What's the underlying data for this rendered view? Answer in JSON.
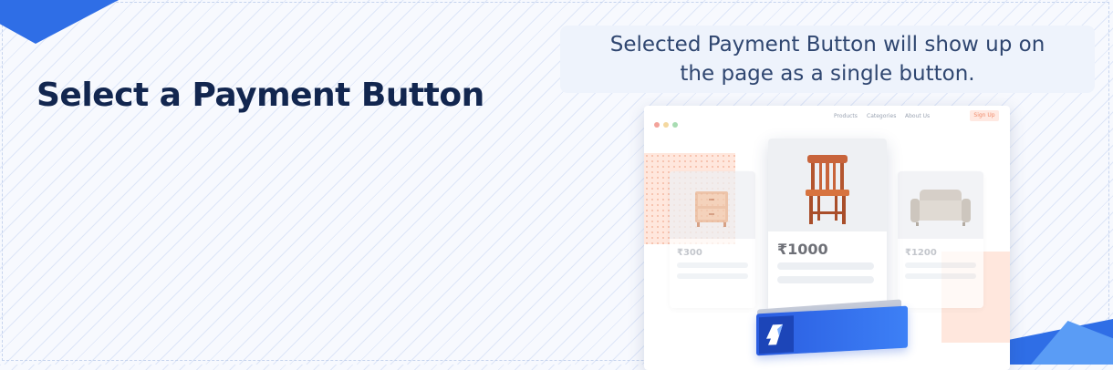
{
  "heading": "Select a Payment Button",
  "caption": {
    "line1": "Selected Payment Button will show up on",
    "line2": "the page as a single button."
  },
  "mock_store": {
    "nav": [
      "Products",
      "Categories",
      "About Us"
    ],
    "signup_label": "Sign Up",
    "products": [
      {
        "name": "nightstand",
        "price": "₹300"
      },
      {
        "name": "chair",
        "price": "₹1000"
      },
      {
        "name": "sofa",
        "price": "₹1200"
      }
    ]
  },
  "payment_button": {
    "icon": "razorpay-logo-icon"
  },
  "colors": {
    "brand_blue": "#2f6ee6",
    "heading": "#12264f",
    "caption_text": "#2f4670",
    "accent_peach": "#ffe7dd",
    "chair_wood": "#c8643b"
  }
}
